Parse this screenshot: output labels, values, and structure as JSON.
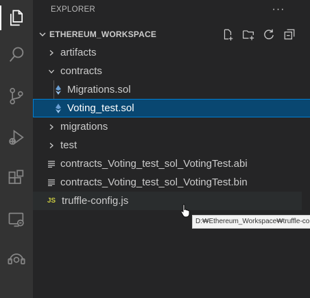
{
  "explorer": {
    "title": "EXPLORER",
    "more_label": "···"
  },
  "workspace": {
    "title": "ETHEREUM_WORKSPACE",
    "actions": [
      "new-file-icon",
      "new-folder-icon",
      "refresh-icon",
      "collapse-all-icon"
    ]
  },
  "tree": [
    {
      "label": "artifacts",
      "kind": "folder",
      "expanded": false,
      "level": 0
    },
    {
      "label": "contracts",
      "kind": "folder",
      "expanded": true,
      "level": 0
    },
    {
      "label": "Migrations.sol",
      "kind": "sol",
      "level": 1
    },
    {
      "label": "Voting_test.sol",
      "kind": "sol",
      "level": 1,
      "selected": true
    },
    {
      "label": "migrations",
      "kind": "folder",
      "expanded": false,
      "level": 0
    },
    {
      "label": "test",
      "kind": "folder",
      "expanded": false,
      "level": 0
    },
    {
      "label": "contracts_Voting_test_sol_VotingTest.abi",
      "kind": "text",
      "level": 0
    },
    {
      "label": "contracts_Voting_test_sol_VotingTest.bin",
      "kind": "text",
      "level": 0
    },
    {
      "label": "truffle-config.js",
      "kind": "js",
      "level": 0,
      "hover": true
    }
  ],
  "tooltip": {
    "text": "D:₩Ethereum_Workspace₩truffle-co"
  },
  "js_badge": "JS",
  "activity_bar": [
    "explorer-icon",
    "search-icon",
    "source-control-icon",
    "run-debug-icon",
    "extensions-icon",
    "remote-explorer-icon",
    "accounts-icon"
  ],
  "colors": {
    "selection": "#094771",
    "selection_border": "#007fd4",
    "sol_icon": "#6a9fd4",
    "js_icon": "#cbcb41"
  }
}
